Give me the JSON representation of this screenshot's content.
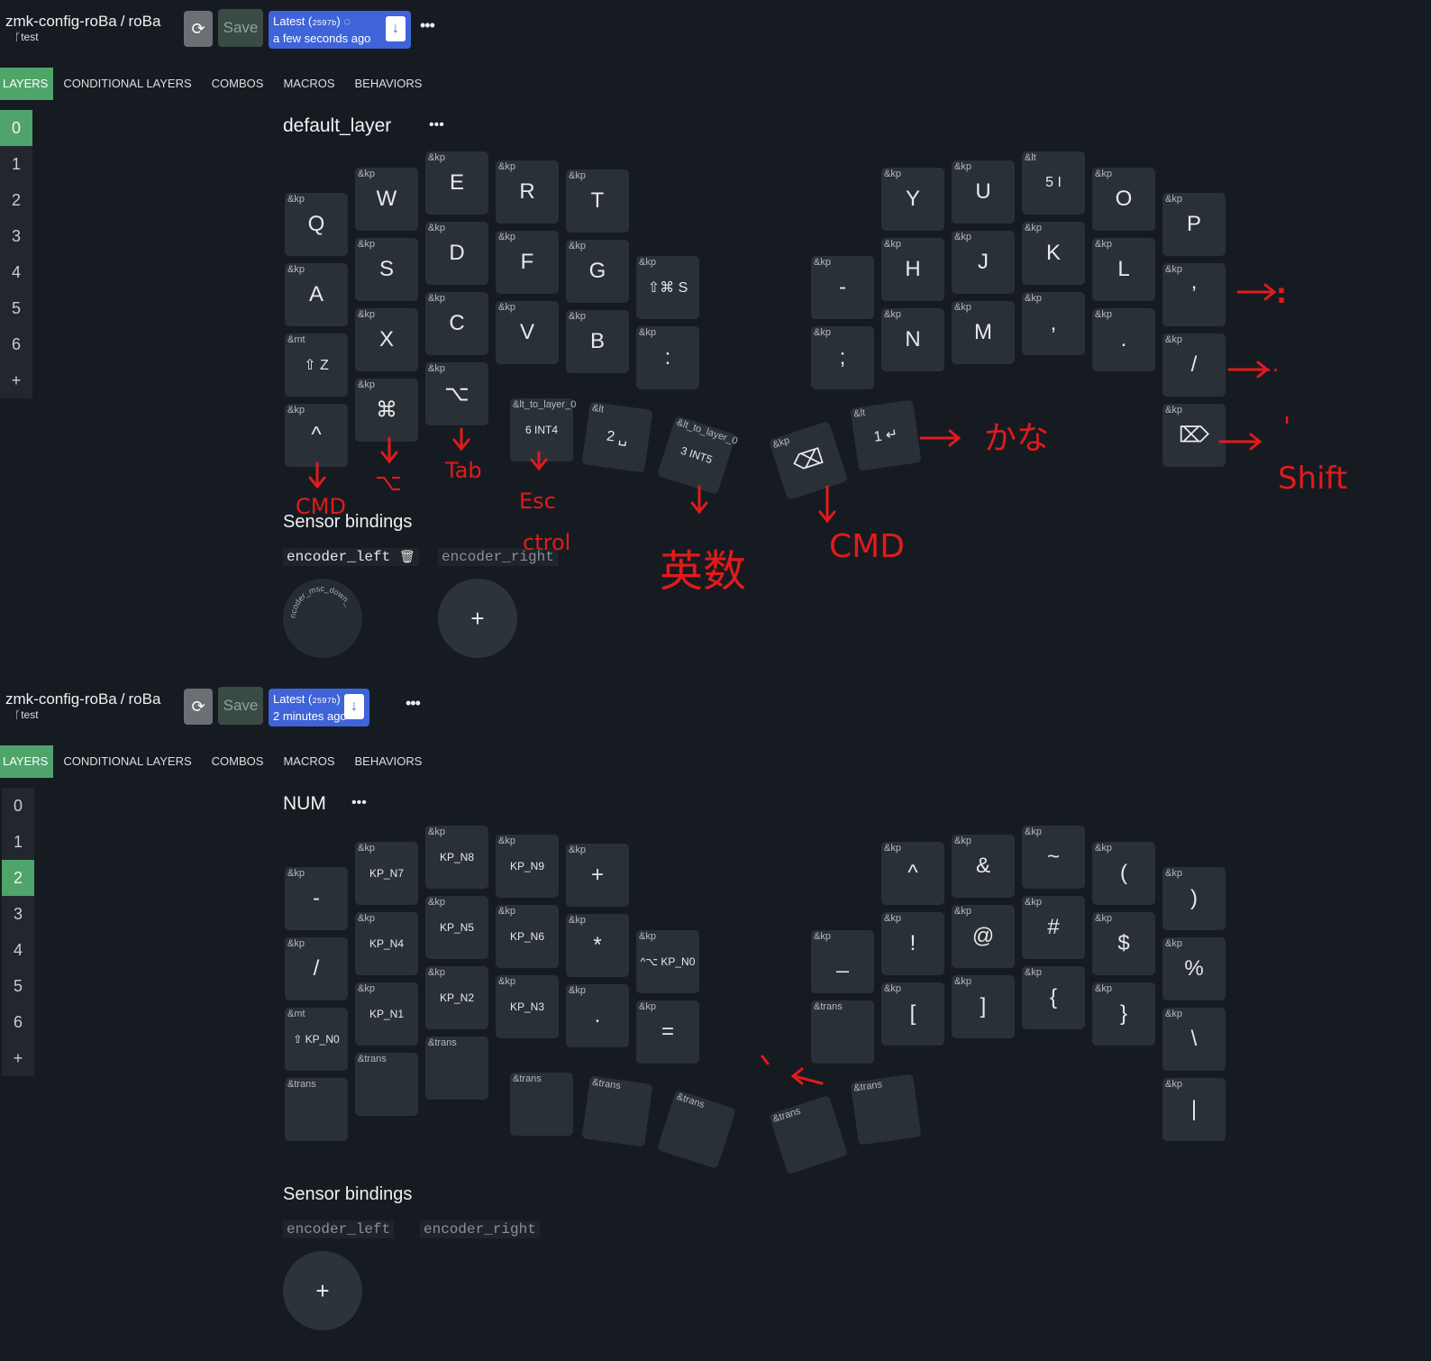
{
  "panels": [
    {
      "repo": "zmk-config-roBa",
      "project": "roBa",
      "branch": "test",
      "save_label": "Save",
      "latest_label": "Latest",
      "sha": "2597b",
      "latest_time": "a few seconds ago",
      "tabs": [
        "LAYERS",
        "CONDITIONAL LAYERS",
        "COMBOS",
        "MACROS",
        "BEHAVIORS"
      ],
      "layers": [
        "0",
        "1",
        "2",
        "3",
        "4",
        "5",
        "6"
      ],
      "add_layer": "+",
      "active_layer": "0",
      "layer_title": "default_layer",
      "sensor_title": "Sensor bindings",
      "encoders": [
        "encoder_left",
        "encoder_right"
      ],
      "knob_label": "ncoder_msc_down_",
      "keys": [
        {
          "b": "&kp",
          "p": "Q"
        },
        {
          "b": "&kp",
          "p": "W"
        },
        {
          "b": "&kp",
          "p": "E"
        },
        {
          "b": "&kp",
          "p": "R"
        },
        {
          "b": "&kp",
          "p": "T"
        },
        {
          "b": "&kp",
          "p": "A"
        },
        {
          "b": "&kp",
          "p": "S"
        },
        {
          "b": "&kp",
          "p": "D"
        },
        {
          "b": "&kp",
          "p": "F"
        },
        {
          "b": "&kp",
          "p": "G"
        },
        {
          "b": "&kp",
          "p": "⇧⌘ S"
        },
        {
          "b": "&mt",
          "p": "⇧ Z"
        },
        {
          "b": "&kp",
          "p": "X"
        },
        {
          "b": "&kp",
          "p": "C"
        },
        {
          "b": "&kp",
          "p": "V"
        },
        {
          "b": "&kp",
          "p": "B"
        },
        {
          "b": "&kp",
          "p": ":"
        },
        {
          "b": "&kp",
          "p": "^"
        },
        {
          "b": "&kp",
          "p": "⌘"
        },
        {
          "b": "&kp",
          "p": "⌥"
        },
        {
          "b": "&lt_to_layer_0",
          "p": "6 INT4"
        },
        {
          "b": "&lt",
          "p": "2 ␣"
        },
        {
          "b": "&lt_to_layer_0",
          "p": "3 INT5"
        },
        {
          "b": "&kp",
          "p": "⌫"
        },
        {
          "b": "&lt",
          "p": "1 ↵"
        },
        {
          "b": "&kp",
          "p": "Y"
        },
        {
          "b": "&kp",
          "p": "U"
        },
        {
          "b": "&lt",
          "p": "5 I"
        },
        {
          "b": "&kp",
          "p": "O"
        },
        {
          "b": "&kp",
          "p": "P"
        },
        {
          "b": "&kp",
          "p": "-"
        },
        {
          "b": "&kp",
          "p": "H"
        },
        {
          "b": "&kp",
          "p": "J"
        },
        {
          "b": "&kp",
          "p": "K"
        },
        {
          "b": "&kp",
          "p": "L"
        },
        {
          "b": "&kp",
          "p": "’"
        },
        {
          "b": "&kp",
          "p": ";"
        },
        {
          "b": "&kp",
          "p": "N"
        },
        {
          "b": "&kp",
          "p": "M"
        },
        {
          "b": "&kp",
          "p": ","
        },
        {
          "b": "&kp",
          "p": "."
        },
        {
          "b": "&kp",
          "p": "/"
        },
        {
          "b": "&kp",
          "p": "⌦"
        }
      ]
    },
    {
      "repo": "zmk-config-roBa",
      "project": "roBa",
      "branch": "test",
      "save_label": "Save",
      "latest_label": "Latest",
      "sha": "2597b",
      "latest_time": "2 minutes ago",
      "tabs": [
        "LAYERS",
        "CONDITIONAL LAYERS",
        "COMBOS",
        "MACROS",
        "BEHAVIORS"
      ],
      "layers": [
        "0",
        "1",
        "2",
        "3",
        "4",
        "5",
        "6"
      ],
      "add_layer": "+",
      "active_layer": "2",
      "layer_title": "NUM",
      "sensor_title": "Sensor bindings",
      "encoders": [
        "encoder_left",
        "encoder_right"
      ],
      "add_sensor": "+",
      "keys": [
        {
          "b": "&kp",
          "p": "-"
        },
        {
          "b": "&kp",
          "p": "KP_N7"
        },
        {
          "b": "&kp",
          "p": "KP_N8"
        },
        {
          "b": "&kp",
          "p": "KP_N9"
        },
        {
          "b": "&kp",
          "p": "+"
        },
        {
          "b": "&kp",
          "p": "/"
        },
        {
          "b": "&kp",
          "p": "KP_N4"
        },
        {
          "b": "&kp",
          "p": "KP_N5"
        },
        {
          "b": "&kp",
          "p": "KP_N6"
        },
        {
          "b": "&kp",
          "p": "*"
        },
        {
          "b": "&kp",
          "p": "^⌥ KP_N0"
        },
        {
          "b": "&mt",
          "p": "⇧ KP_N0"
        },
        {
          "b": "&kp",
          "p": "KP_N1"
        },
        {
          "b": "&kp",
          "p": "KP_N2"
        },
        {
          "b": "&kp",
          "p": "KP_N3"
        },
        {
          "b": "&kp",
          "p": "."
        },
        {
          "b": "&kp",
          "p": "="
        },
        {
          "b": "&trans",
          "p": ""
        },
        {
          "b": "&trans",
          "p": ""
        },
        {
          "b": "&trans",
          "p": ""
        },
        {
          "b": "&trans",
          "p": ""
        },
        {
          "b": "&trans",
          "p": ""
        },
        {
          "b": "&trans",
          "p": ""
        },
        {
          "b": "&trans",
          "p": ""
        },
        {
          "b": "&trans",
          "p": ""
        },
        {
          "b": "&kp",
          "p": "^"
        },
        {
          "b": "&kp",
          "p": "&"
        },
        {
          "b": "&kp",
          "p": "~"
        },
        {
          "b": "&kp",
          "p": "("
        },
        {
          "b": "&kp",
          "p": ")"
        },
        {
          "b": "&kp",
          "p": "_"
        },
        {
          "b": "&kp",
          "p": "!"
        },
        {
          "b": "&kp",
          "p": "@"
        },
        {
          "b": "&kp",
          "p": "#"
        },
        {
          "b": "&kp",
          "p": "$"
        },
        {
          "b": "&kp",
          "p": "%"
        },
        {
          "b": "&trans",
          "p": ""
        },
        {
          "b": "&kp",
          "p": "["
        },
        {
          "b": "&kp",
          "p": "]"
        },
        {
          "b": "&kp",
          "p": "{"
        },
        {
          "b": "&kp",
          "p": "}"
        },
        {
          "b": "&kp",
          "p": "\\"
        },
        {
          "b": "&kp",
          "p": "|"
        }
      ]
    }
  ],
  "annotations": {
    "color": "#e11b1b",
    "labels": [
      "CMD",
      "⌥",
      "Tab",
      "Esc",
      "ctrol",
      "英数",
      "CMD",
      "かな",
      ":",
      "..",
      "'",
      "Shift"
    ]
  }
}
